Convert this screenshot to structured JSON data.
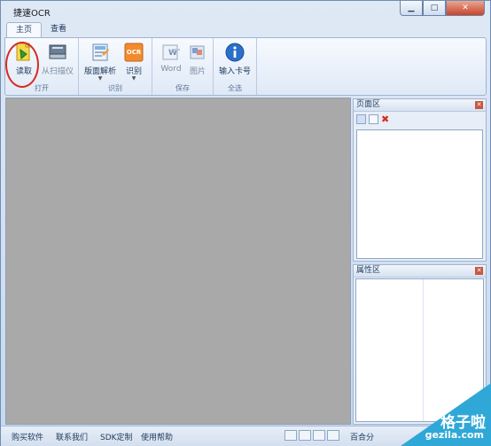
{
  "window": {
    "title": "捷速OCR",
    "min": "▁",
    "max": "□",
    "close": "✕"
  },
  "tabs": [
    {
      "label": "主页"
    },
    {
      "label": "查看"
    }
  ],
  "ribbon": {
    "groups": [
      {
        "label": "打开",
        "buttons": [
          {
            "label": "读取",
            "icon": "read-file-icon"
          },
          {
            "label": "从扫描仪",
            "icon": "scanner-icon"
          }
        ]
      },
      {
        "label": "识别",
        "buttons": [
          {
            "label": "版面解析",
            "icon": "layout-analysis-icon"
          },
          {
            "label": "识别",
            "icon": "ocr-icon",
            "icon_text": "OCR"
          }
        ]
      },
      {
        "label": "保存",
        "buttons": [
          {
            "label": "Word",
            "icon": "word-icon"
          },
          {
            "label": "图片",
            "icon": "image-icon"
          }
        ]
      },
      {
        "label": "全选",
        "buttons": [
          {
            "label": "输入卡号",
            "icon": "info-icon"
          }
        ]
      }
    ]
  },
  "panels": {
    "page_area": {
      "title": "页面区"
    },
    "property_area": {
      "title": "属性区"
    }
  },
  "statusbar": {
    "links": [
      "购买软件",
      "联系我们",
      "SDK定制",
      "使用帮助"
    ],
    "right_text": "百合分"
  },
  "watermark": {
    "line1": "格子啦",
    "line2": "gezila.com"
  },
  "colors": {
    "highlight": "#d62b1f",
    "canvas": "#a9a9a9",
    "watermark": "#2fa8d8"
  }
}
